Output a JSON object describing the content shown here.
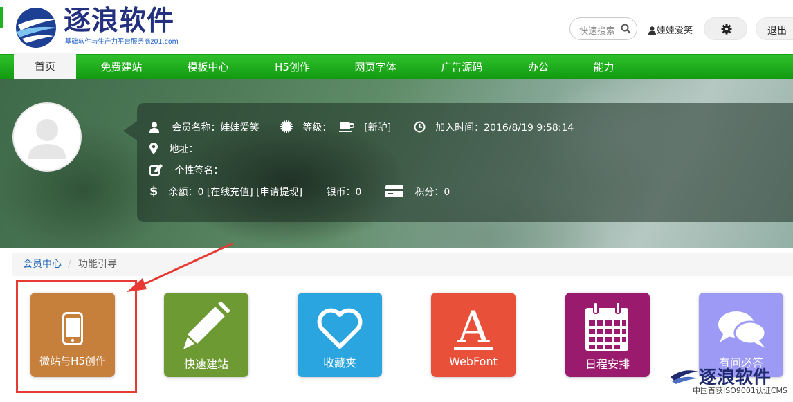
{
  "header": {
    "logo_title": "逐浪软件",
    "logo_subtitle": "基础软件与生产力平台服务商z01.com",
    "search_placeholder": "快速搜索",
    "username": "娃娃爱笑",
    "logout": "退出"
  },
  "nav": {
    "items": [
      {
        "label": "首页"
      },
      {
        "label": "免费建站"
      },
      {
        "label": "模板中心"
      },
      {
        "label": "H5创作"
      },
      {
        "label": "网页字体"
      },
      {
        "label": "广告源码"
      },
      {
        "label": "办公"
      },
      {
        "label": "能力"
      }
    ]
  },
  "profile": {
    "member_name": "会员名称：娃娃爱笑",
    "level_label": "等级：",
    "level_value": "[新驴]",
    "join_time": "加入时间：2016/8/19 9:58:14",
    "address": "地址：",
    "signature": "个性签名：",
    "balance": "余额：0 [在线充值] [申请提现]",
    "silver": "银币：0",
    "points": "积分：0"
  },
  "breadcrumb": {
    "home": "会员中心",
    "separator": "/",
    "current": "功能引导"
  },
  "tiles": [
    {
      "label": "微站与H5创作",
      "color": "#c77f3c",
      "icon": "mobile-phone-icon"
    },
    {
      "label": "快速建站",
      "color": "#6d9a33",
      "icon": "pencil-icon"
    },
    {
      "label": "收藏夹",
      "color": "#2aa5df",
      "icon": "heart-icon"
    },
    {
      "label": "WebFont",
      "color": "#e8503a",
      "icon": "font-a-icon"
    },
    {
      "label": "日程安排",
      "color": "#9a1a6e",
      "icon": "calendar-icon"
    },
    {
      "label": "有问必答",
      "color": "#9d9af5",
      "icon": "chat-bubbles-icon"
    }
  ],
  "watermark": {
    "title": "逐浪软件",
    "subtitle": "中国首获ISO9001认证CMS"
  },
  "colors": {
    "nav_green": "#1faa1d",
    "highlight_red": "#e63a33",
    "brand_blue": "#23307e"
  }
}
